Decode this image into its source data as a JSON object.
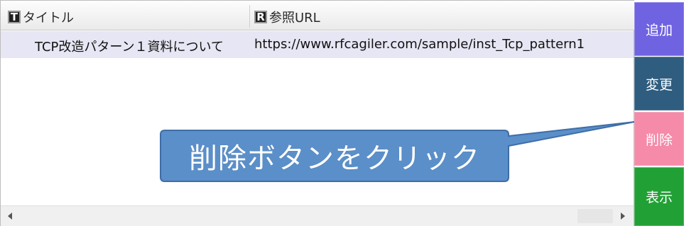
{
  "grid": {
    "columns": [
      {
        "icon": "T",
        "label": "タイトル"
      },
      {
        "icon": "R",
        "label": "参照URL"
      }
    ],
    "rows": [
      {
        "title": "TCP改造パターン１資料について",
        "url": "https://www.rfcagiler.com/sample/inst_Tcp_pattern1"
      }
    ]
  },
  "buttons": {
    "add": "追加",
    "change": "変更",
    "delete": "削除",
    "show": "表示"
  },
  "callout": {
    "text": "削除ボタンをクリック"
  },
  "colors": {
    "add": "#6f63e2",
    "change": "#2f5d7f",
    "delete": "#f58aa9",
    "show": "#21a135",
    "callout": "#5b8fc9"
  }
}
